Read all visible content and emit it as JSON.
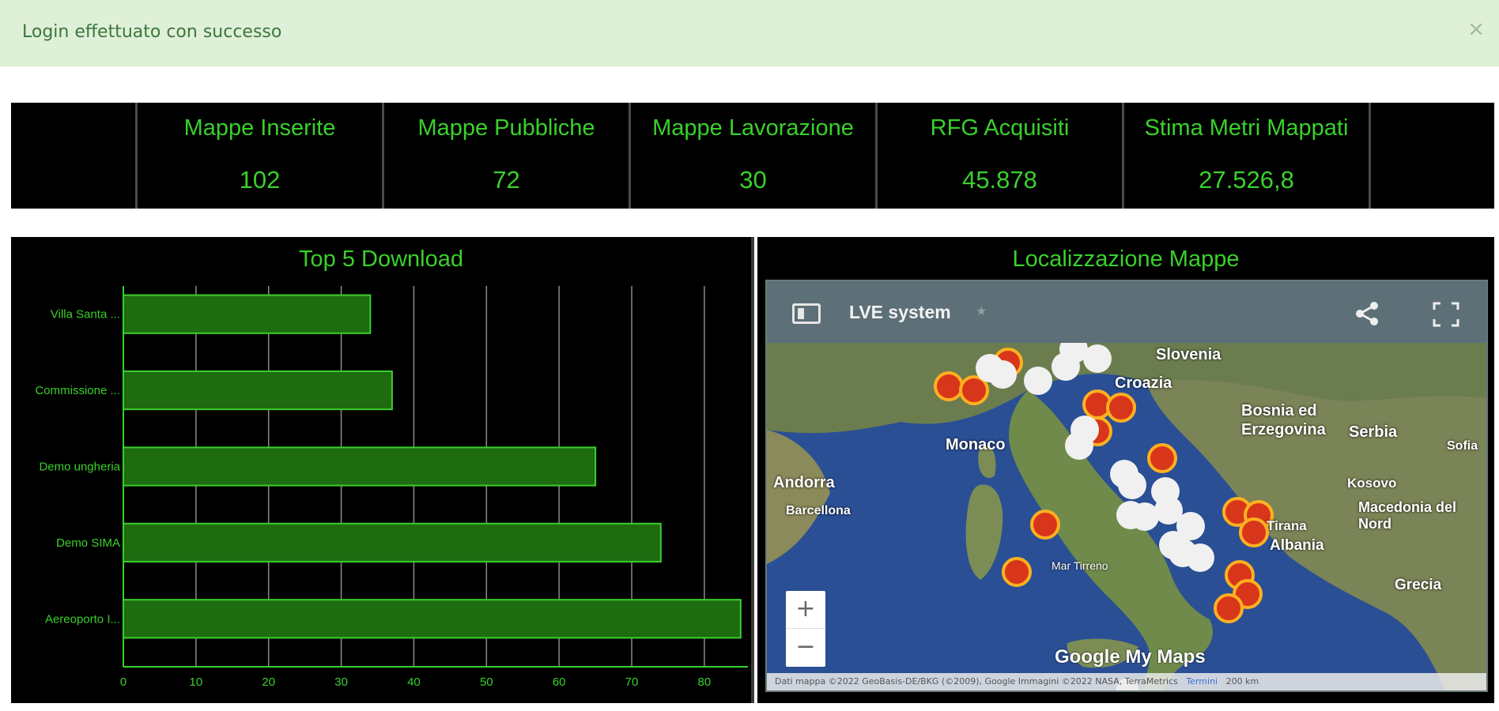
{
  "alert": {
    "message": "Login effettuato con successo",
    "close": "×"
  },
  "stats": [
    {
      "title": "Mappe Inserite",
      "value": "102"
    },
    {
      "title": "Mappe Pubbliche",
      "value": "72"
    },
    {
      "title": "Mappe Lavorazione",
      "value": "30"
    },
    {
      "title": "RFG Acquisiti",
      "value": "45.878"
    },
    {
      "title": "Stima Metri Mappati",
      "value": "27.526,8"
    }
  ],
  "chart_panel": {
    "title": "Top 5 Download"
  },
  "map_panel": {
    "title": "Localizzazione Mappe",
    "map_name": "LVE system",
    "star": "★",
    "zoom_in": "+",
    "zoom_out": "−",
    "google": "Google My Maps",
    "attribution": "Dati mappa ©2022 GeoBasis-DE/BKG (©2009), Google Immagini ©2022 NASA, TerraMetrics",
    "attribution_link": "Termini",
    "scale": "200 km",
    "labels": {
      "slovenia": "Slovenia",
      "croazia": "Croazia",
      "bosnia": "Bosnia ed Erzegovina",
      "serbia": "Serbia",
      "monaco": "Monaco",
      "andorra": "Andorra",
      "barcellona": "Barcellona",
      "kosovo": "Kosovo",
      "macedonia": "Macedonia del Nord",
      "tirana": "Tirana",
      "albania": "Albania",
      "grecia": "Grecia",
      "sofia": "Sofia",
      "mar_tirreno": "Mar Tirreno"
    }
  },
  "colors": {
    "accent": "#3ad02c",
    "bar_fill": "#1e6b10",
    "background": "#000000",
    "alert_bg": "#dff0d8"
  },
  "chart_data": {
    "type": "bar",
    "orientation": "horizontal",
    "categories": [
      "Villa Santa ...",
      "Commissione ...",
      "Demo ungheria",
      "Demo SIMA",
      "Aereoporto I..."
    ],
    "values": [
      34,
      37,
      65,
      74,
      85
    ],
    "title": "Top 5 Download",
    "xlim": [
      0,
      86
    ],
    "xticks": [
      "0",
      "10",
      "20",
      "30",
      "40",
      "50",
      "60",
      "70",
      "80"
    ],
    "grid": true
  }
}
